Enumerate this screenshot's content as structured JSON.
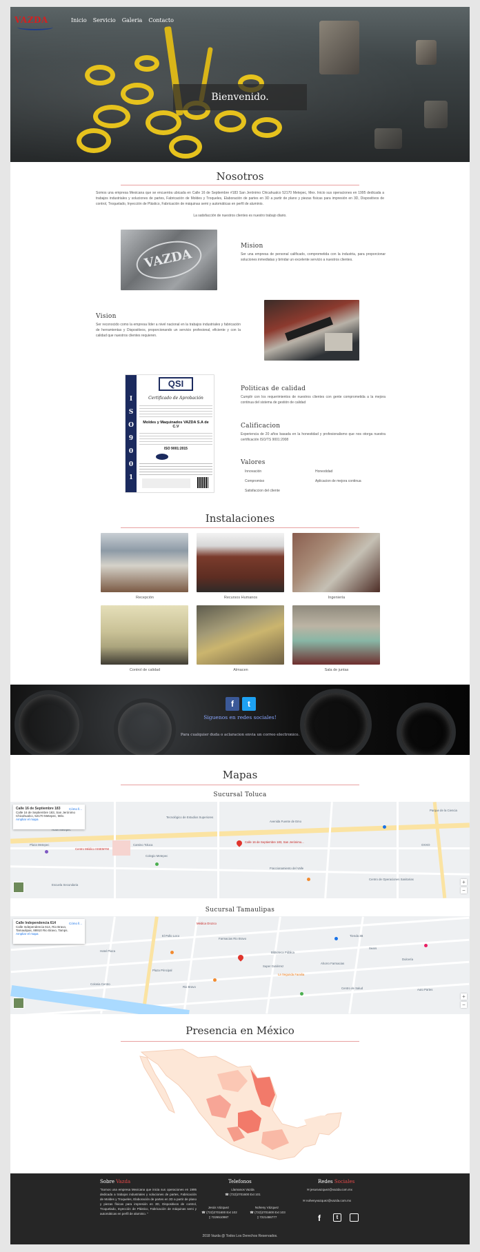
{
  "brand": {
    "logo_text": "VAZDA"
  },
  "nav": {
    "items": [
      "Inicio",
      "Servicio",
      "Galeria",
      "Contacto"
    ]
  },
  "hero": {
    "title": "Bienvenido."
  },
  "about": {
    "title": "Nosotros",
    "intro": "Somos una empresa Mexicana que se encuentra ubicada en Calle 16 de Septiembre #183 San Jerónimo Chicahualco 52170 Metepec, Mex. Inicio sus operaciones en 1995 dedicada a trabajos industriales y soluciones de partes, Fabricación de Moldes y Troqueles, Elaboración de partes en 3D a partir de plano y piezas físicas para impresión en 3D, Dispositivos de control, Troquelado, Inyección de Plástico, Fabricación de máquinas semi y automáticas en perfil de aluminio.",
    "tagline": "La satisfacción de nuestros clientes es nuestro trabajo diario.",
    "mission_title": "Mision",
    "mission_text": "Ser una empresa de personal calificado, comprometida con la industria, para proporcionar soluciones inmediatas y brindar un excelente servicio a nuestros clientes.",
    "vision_title": "Vision",
    "vision_text": "Ser reconocido como la empresa líder a nivel nacional en la trabajos industriales y fabricación de herramientas y Dispositivos, proporcionando un servicio profesional, eficiente y con la calidad que nuestros clientes requieren.",
    "quality_title": "Politicas de calidad",
    "quality_text": "Cumplir con los requerimientos de nuestros clientes con gente comprometida a la mejora continua del sistema de gestión de calidad",
    "cert_title": "Calificacion",
    "cert_text": "Experiencia de 20 años basada en la honestidad y profesionalismo que nos otorga nuestra certificación ISO/TS 9001:2008",
    "values_title": "Valores",
    "values": [
      "Innovación",
      "Honestidad",
      "Compromiso",
      "Aplicacion de mejora continua",
      "Satisfaccion del cliente"
    ],
    "certificate": {
      "brand": "QSI",
      "iso_letters": [
        "I",
        "S",
        "O",
        "9",
        "0",
        "0",
        "1"
      ],
      "heading": "Certificado de Aprobación",
      "company": "Moldes y Maquinados VAZDA S.A de C.V",
      "standard": "ISO 9001:2015"
    }
  },
  "facilities": {
    "title": "Instalaciones",
    "items": [
      {
        "caption": "Recepción",
        "color": "#7b5a44"
      },
      {
        "caption": "Recursos Humanos",
        "color": "#6b3528"
      },
      {
        "caption": "Ingeniería",
        "color": "#8a6d5a"
      },
      {
        "caption": "Control de calidad",
        "color": "#8e8a6e"
      },
      {
        "caption": "Almacen",
        "color": "#6d5f44"
      },
      {
        "caption": "Sala de juntas",
        "color": "#6f6a5f"
      }
    ]
  },
  "social": {
    "facebook_icon": "f",
    "twitter_icon": "t",
    "title": "Siguenos en redes sociales!",
    "subtitle": "Para cualquier duda o aclaracion envia un correo electronico."
  },
  "maps": {
    "title": "Mapas",
    "toluca": {
      "title": "Sucursal Toluca",
      "card_title": "Calle 16 de Septiembre 183",
      "card_address": "Calle 16 de Septiembre 183, San Jerónimo Chicahualco, 52170 Metepec, Méx.",
      "card_link": "Ampliar el mapa",
      "directions": "Cómo ll...",
      "pin_label": "Calle 16 de Septiembre 183, San Jerónimo...",
      "labels": [
        "Hotel Metepec",
        "Centro Médico ISSEMYM",
        "Camino Toluca",
        "Colegio Metepec",
        "Plaza Metepec",
        "Tecnológico de Estudios Superiores",
        "Avenida Fuente de Emo",
        "Fraccionamiento del Valle",
        "Centro de Operaciones Sanitarias",
        "OXXO",
        "Escuela Secundaria",
        "Parque de la Ciencia"
      ]
    },
    "tamaulipas": {
      "title": "Sucursal Tamaulipas",
      "card_title": "Calle Independencia 614",
      "card_address": "Calle Independencia 614, Rio Bravo, Tamaulipas, 88910 Rio Bravo, Tamps.",
      "card_link": "Ampliar el mapa",
      "directions": "Cómo ll...",
      "labels": [
        "Médica Orozco",
        "El Pollo Loco",
        "Farmacias Rio Bravo",
        "Plaza Principal",
        "Super Gutiérrez",
        "Biblioteca Pública",
        "Rio Bravo",
        "La Segunda Familia",
        "Tienda 3B",
        "Sears",
        "Ahorro Farmacias",
        "Auto Partes",
        "Centro de Salud",
        "Hotel Plaza",
        "Colonia Centro",
        "Dulcería"
      ]
    }
  },
  "presence": {
    "title": "Presencia en México"
  },
  "footer": {
    "about_title_1": "Sobre ",
    "about_title_2": "Vazda",
    "about_text": "\"Somos una empresa Mexicana que inicia sus operaciones en 1995 dedicada a trabajos industriales y soluciones de partes, Fabricación de Moldes y Troqueles, Elaboración de partes en 3D a partir de plano y piezas físicas para impresión en 3D, Dispositivos de control, Troquelado, Inyección de Plástico, Fabricación de máquinas semi y automáticas en perfil de aluminio. \"",
    "phones_title": "Telefonos",
    "phones_main_label": "Llamanos Vazda",
    "phones_main": "(722)2701600 Ext 101",
    "contact1_name": "Jesús Vázquez",
    "contact1_phone": "(722)2701600 Ext 102",
    "contact1_cell": "7226510987",
    "contact2_name": "Noheny Vázquez",
    "contact2_phone": "(722)2701600 Ext 103",
    "contact2_cell": "7221486777",
    "social_title_1": "Redes ",
    "social_title_2": "Sociales",
    "email1": "jesusvazquez@vazda.com.mx",
    "email2": "nohenyvazquez@vazda.com.mx",
    "copyright": "2018 Vazda @ Todos Los Derechos Reservados."
  },
  "colors": {
    "accent": "#e64a4a",
    "facebook": "#3b5998",
    "twitter": "#1da1f2",
    "footer_bg": "#262626"
  }
}
